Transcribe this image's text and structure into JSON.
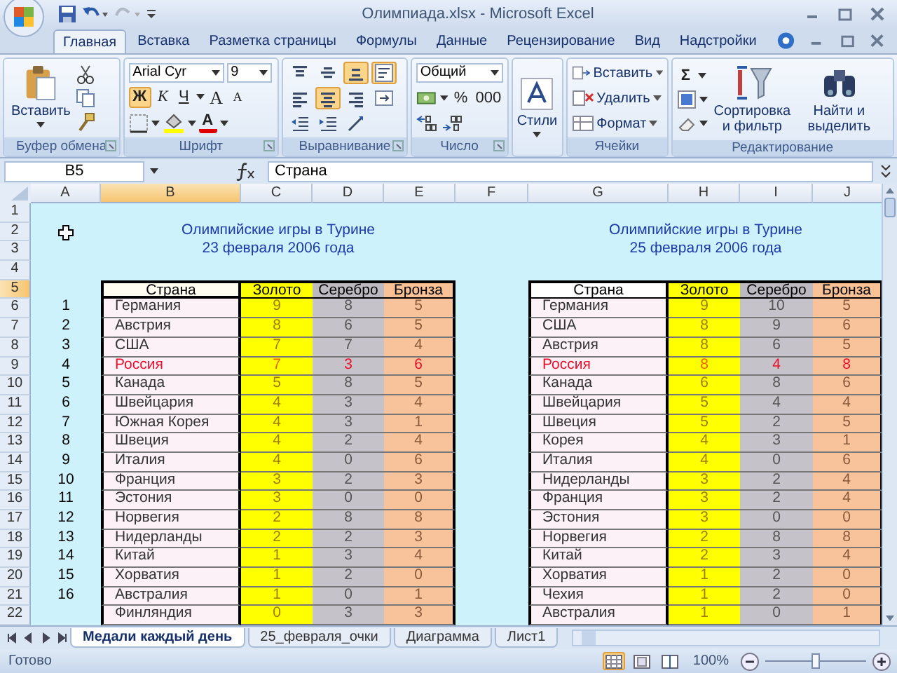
{
  "title_bar": {
    "title": "Олимпиада.xlsx - Microsoft Excel"
  },
  "ribbon_tabs": [
    {
      "label": "Главная",
      "selected": true
    },
    {
      "label": "Вставка",
      "selected": false
    },
    {
      "label": "Разметка страницы",
      "selected": false
    },
    {
      "label": "Формулы",
      "selected": false
    },
    {
      "label": "Данные",
      "selected": false
    },
    {
      "label": "Рецензирование",
      "selected": false
    },
    {
      "label": "Вид",
      "selected": false
    },
    {
      "label": "Надстройки",
      "selected": false
    }
  ],
  "ribbon": {
    "clipboard": {
      "label": "Буфер обмена",
      "paste": "Вставить"
    },
    "font": {
      "label": "Шрифт",
      "font_name": "Arial Cyr",
      "font_size": "9",
      "styles": [
        {
          "text": "Ж",
          "kind": "bold",
          "selected": true
        },
        {
          "text": "К",
          "kind": "italic",
          "selected": false
        },
        {
          "text": "Ч",
          "kind": "underline",
          "selected": false
        }
      ],
      "grow": "A",
      "shrink": "A",
      "color_button": "A"
    },
    "alignment": {
      "label": "Выравнивание",
      "rows": [
        [
          {
            "kind": "top",
            "selected": false
          },
          {
            "kind": "middle",
            "selected": false
          },
          {
            "kind": "bottom",
            "selected": true
          },
          {
            "kind": "wrap",
            "selected": true
          }
        ],
        [
          {
            "kind": "left",
            "selected": false
          },
          {
            "kind": "center",
            "selected": true
          },
          {
            "kind": "right",
            "selected": false
          },
          {
            "kind": "merge",
            "selected": false
          }
        ],
        [
          {
            "kind": "outdent",
            "selected": false
          },
          {
            "kind": "indent",
            "selected": false
          },
          {
            "kind": "orientation",
            "selected": false
          }
        ]
      ]
    },
    "number": {
      "label": "Число",
      "format": "Общий",
      "percent": "%",
      "thousands": "000"
    },
    "styles": {
      "button": "Стили"
    },
    "cells": {
      "label": "Ячейки",
      "buttons": [
        {
          "label": "Вставить",
          "kind": "insert"
        },
        {
          "label": "Удалить",
          "kind": "delete"
        },
        {
          "label": "Формат",
          "kind": "format"
        }
      ]
    },
    "editing": {
      "label": "Редактирование",
      "sum": "Σ",
      "sort": "Сортировка и фильтр",
      "find": "Найти и выделить"
    }
  },
  "formula_bar": {
    "name_box": "B5",
    "formula": "Страна"
  },
  "columns": [
    {
      "label": "A",
      "selected": false
    },
    {
      "label": "B",
      "selected": true
    },
    {
      "label": "C",
      "selected": false
    },
    {
      "label": "D",
      "selected": false
    },
    {
      "label": "E",
      "selected": false
    },
    {
      "label": "F",
      "selected": false
    },
    {
      "label": "G",
      "selected": false
    },
    {
      "label": "H",
      "selected": false
    },
    {
      "label": "I",
      "selected": false
    },
    {
      "label": "J",
      "selected": false
    }
  ],
  "row_headers": [
    {
      "label": "1",
      "selected": false
    },
    {
      "label": "2",
      "selected": false
    },
    {
      "label": "3",
      "selected": false
    },
    {
      "label": "4",
      "selected": false
    },
    {
      "label": "5",
      "selected": true
    },
    {
      "label": "6",
      "selected": false
    },
    {
      "label": "7",
      "selected": false
    },
    {
      "label": "8",
      "selected": false
    },
    {
      "label": "9",
      "selected": false
    },
    {
      "label": "10",
      "selected": false
    },
    {
      "label": "11",
      "selected": false
    },
    {
      "label": "12",
      "selected": false
    },
    {
      "label": "13",
      "selected": false
    },
    {
      "label": "14",
      "selected": false
    },
    {
      "label": "15",
      "selected": false
    },
    {
      "label": "16",
      "selected": false
    },
    {
      "label": "17",
      "selected": false
    },
    {
      "label": "18",
      "selected": false
    },
    {
      "label": "19",
      "selected": false
    },
    {
      "label": "20",
      "selected": false
    },
    {
      "label": "21",
      "selected": false
    },
    {
      "label": "22",
      "selected": false
    }
  ],
  "tables": [
    {
      "title": [
        "Олимпийские игры в Турине",
        "23 февраля 2006 года"
      ],
      "headers": [
        "Страна",
        "Золото",
        "Серебро",
        "Бронза"
      ],
      "header_selected": true,
      "rows": [
        {
          "rank": "1",
          "country": "Германия",
          "gold": "9",
          "silver": "8",
          "bronze": "5",
          "highlight": false
        },
        {
          "rank": "2",
          "country": "Австрия",
          "gold": "8",
          "silver": "6",
          "bronze": "5",
          "highlight": false
        },
        {
          "rank": "3",
          "country": "США",
          "gold": "7",
          "silver": "7",
          "bronze": "4",
          "highlight": false
        },
        {
          "rank": "4",
          "country": "Россия",
          "gold": "7",
          "silver": "3",
          "bronze": "6",
          "highlight": true
        },
        {
          "rank": "5",
          "country": "Канада",
          "gold": "5",
          "silver": "8",
          "bronze": "5",
          "highlight": false
        },
        {
          "rank": "6",
          "country": "Швейцария",
          "gold": "4",
          "silver": "3",
          "bronze": "4",
          "highlight": false
        },
        {
          "rank": "7",
          "country": "Южная Корея",
          "gold": "4",
          "silver": "3",
          "bronze": "1",
          "highlight": false
        },
        {
          "rank": "8",
          "country": "Швеция",
          "gold": "4",
          "silver": "2",
          "bronze": "4",
          "highlight": false
        },
        {
          "rank": "9",
          "country": "Италия",
          "gold": "4",
          "silver": "0",
          "bronze": "6",
          "highlight": false
        },
        {
          "rank": "10",
          "country": "Франция",
          "gold": "3",
          "silver": "2",
          "bronze": "3",
          "highlight": false
        },
        {
          "rank": "11",
          "country": "Эстония",
          "gold": "3",
          "silver": "0",
          "bronze": "0",
          "highlight": false
        },
        {
          "rank": "12",
          "country": "Норвегия",
          "gold": "2",
          "silver": "8",
          "bronze": "8",
          "highlight": false
        },
        {
          "rank": "13",
          "country": "Нидерланды",
          "gold": "2",
          "silver": "2",
          "bronze": "3",
          "highlight": false
        },
        {
          "rank": "14",
          "country": "Китай",
          "gold": "1",
          "silver": "3",
          "bronze": "4",
          "highlight": false
        },
        {
          "rank": "15",
          "country": "Хорватия",
          "gold": "1",
          "silver": "2",
          "bronze": "0",
          "highlight": false
        },
        {
          "rank": "16",
          "country": "Австралия",
          "gold": "1",
          "silver": "0",
          "bronze": "1",
          "highlight": false
        },
        {
          "country": "Финляндия",
          "gold": "0",
          "silver": "3",
          "bronze": "3",
          "highlight": false
        }
      ]
    },
    {
      "title": [
        "Олимпийские игры в Турине",
        "25 февраля 2006 года"
      ],
      "headers": [
        "Страна",
        "Золото",
        "Серебро",
        "Бронза"
      ],
      "header_selected": false,
      "rows": [
        {
          "country": "Германия",
          "gold": "9",
          "silver": "10",
          "bronze": "5",
          "highlight": false
        },
        {
          "country": "США",
          "gold": "8",
          "silver": "9",
          "bronze": "6",
          "highlight": false
        },
        {
          "country": "Австрия",
          "gold": "8",
          "silver": "6",
          "bronze": "5",
          "highlight": false
        },
        {
          "country": "Россия",
          "gold": "8",
          "silver": "4",
          "bronze": "8",
          "highlight": true
        },
        {
          "country": "Канада",
          "gold": "6",
          "silver": "8",
          "bronze": "6",
          "highlight": false
        },
        {
          "country": "Швейцария",
          "gold": "5",
          "silver": "4",
          "bronze": "4",
          "highlight": false
        },
        {
          "country": "Швеция",
          "gold": "5",
          "silver": "2",
          "bronze": "5",
          "highlight": false
        },
        {
          "country": "Корея",
          "gold": "4",
          "silver": "3",
          "bronze": "1",
          "highlight": false
        },
        {
          "country": "Италия",
          "gold": "4",
          "silver": "0",
          "bronze": "6",
          "highlight": false
        },
        {
          "country": "Нидерланды",
          "gold": "3",
          "silver": "2",
          "bronze": "4",
          "highlight": false
        },
        {
          "country": "Франция",
          "gold": "3",
          "silver": "2",
          "bronze": "4",
          "highlight": false
        },
        {
          "country": "Эстония",
          "gold": "3",
          "silver": "0",
          "bronze": "0",
          "highlight": false
        },
        {
          "country": "Норвегия",
          "gold": "2",
          "silver": "8",
          "bronze": "8",
          "highlight": false
        },
        {
          "country": "Китай",
          "gold": "2",
          "silver": "3",
          "bronze": "4",
          "highlight": false
        },
        {
          "country": "Хорватия",
          "gold": "1",
          "silver": "2",
          "bronze": "0",
          "highlight": false
        },
        {
          "country": "Чехия",
          "gold": "1",
          "silver": "2",
          "bronze": "0",
          "highlight": false
        },
        {
          "country": "Австралия",
          "gold": "1",
          "silver": "0",
          "bronze": "1",
          "highlight": false
        }
      ]
    }
  ],
  "sheet_tabs": [
    {
      "label": "Медали каждый день",
      "selected": true
    },
    {
      "label": "25_февраля_очки",
      "selected": false
    },
    {
      "label": "Диаграмма",
      "selected": false
    },
    {
      "label": "Лист1",
      "selected": false
    }
  ],
  "status_bar": {
    "status": "Готово",
    "views": [
      {
        "kind": "normal",
        "selected": true
      },
      {
        "kind": "layout",
        "selected": false
      },
      {
        "kind": "pagebreak",
        "selected": false
      }
    ],
    "zoom": "100%",
    "zoom_slider": {
      "level": 0.5
    }
  }
}
